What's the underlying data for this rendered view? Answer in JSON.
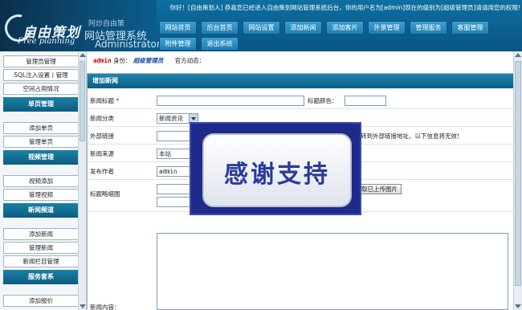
{
  "header": {
    "logo_main": "自由策划",
    "logo_sub": "Free planning",
    "brand": "阿炒自由策",
    "system_name": "网站管理系统",
    "admin_en": "Administrator",
    "welcome": "你好！[自由策划人] 恭喜您已经进入自由策划网站管理系统后台，你的用户名为[admin]现在的级别为[超级管理员]请请用您的权限!"
  },
  "nav": [
    "网站首页",
    "后台首页",
    "网站设置",
    "添加新闻",
    "添加客片",
    "外景管理",
    "管理服务",
    "客服管理",
    "附件管理",
    "退出系统"
  ],
  "sidebar": {
    "items_top": [
      "管理员管理",
      "SQL注入设置丨管理",
      "空间占用情况"
    ],
    "sections": [
      {
        "title": "单页管理",
        "items": [
          "添加单页",
          "管理单页"
        ]
      },
      {
        "title": "视频管理",
        "items": [
          "视频添加",
          "管理视频"
        ]
      },
      {
        "title": "新闻频道",
        "items": [
          "添加新闻",
          "管理新闻",
          "新闻栏目管理"
        ]
      },
      {
        "title": "服务套系",
        "items": [
          "添加报价"
        ]
      }
    ]
  },
  "admin_bar": {
    "username": "admin",
    "role_label": "身份：",
    "role": "超级管理员",
    "dynamic_label": "官方动态："
  },
  "form": {
    "title": "增加新闻",
    "news_title_label": "新闻标题",
    "required_mark": "*",
    "title_color_label": "标题颜色：",
    "category_label": "新闻分类",
    "category_value": "新闻资讯",
    "external_link_label": "外部链接",
    "external_link_note": "转到外部链接地址。以下信息将无效!",
    "source_label": "新闻来源",
    "source_value": "本站",
    "author_label": "发布作者",
    "author_value": "admin",
    "thumb_label": "标题略缩图",
    "upload_button": "取已上传图片",
    "content_label": "新闻内容："
  },
  "overlay": {
    "text": "感谢支持"
  }
}
